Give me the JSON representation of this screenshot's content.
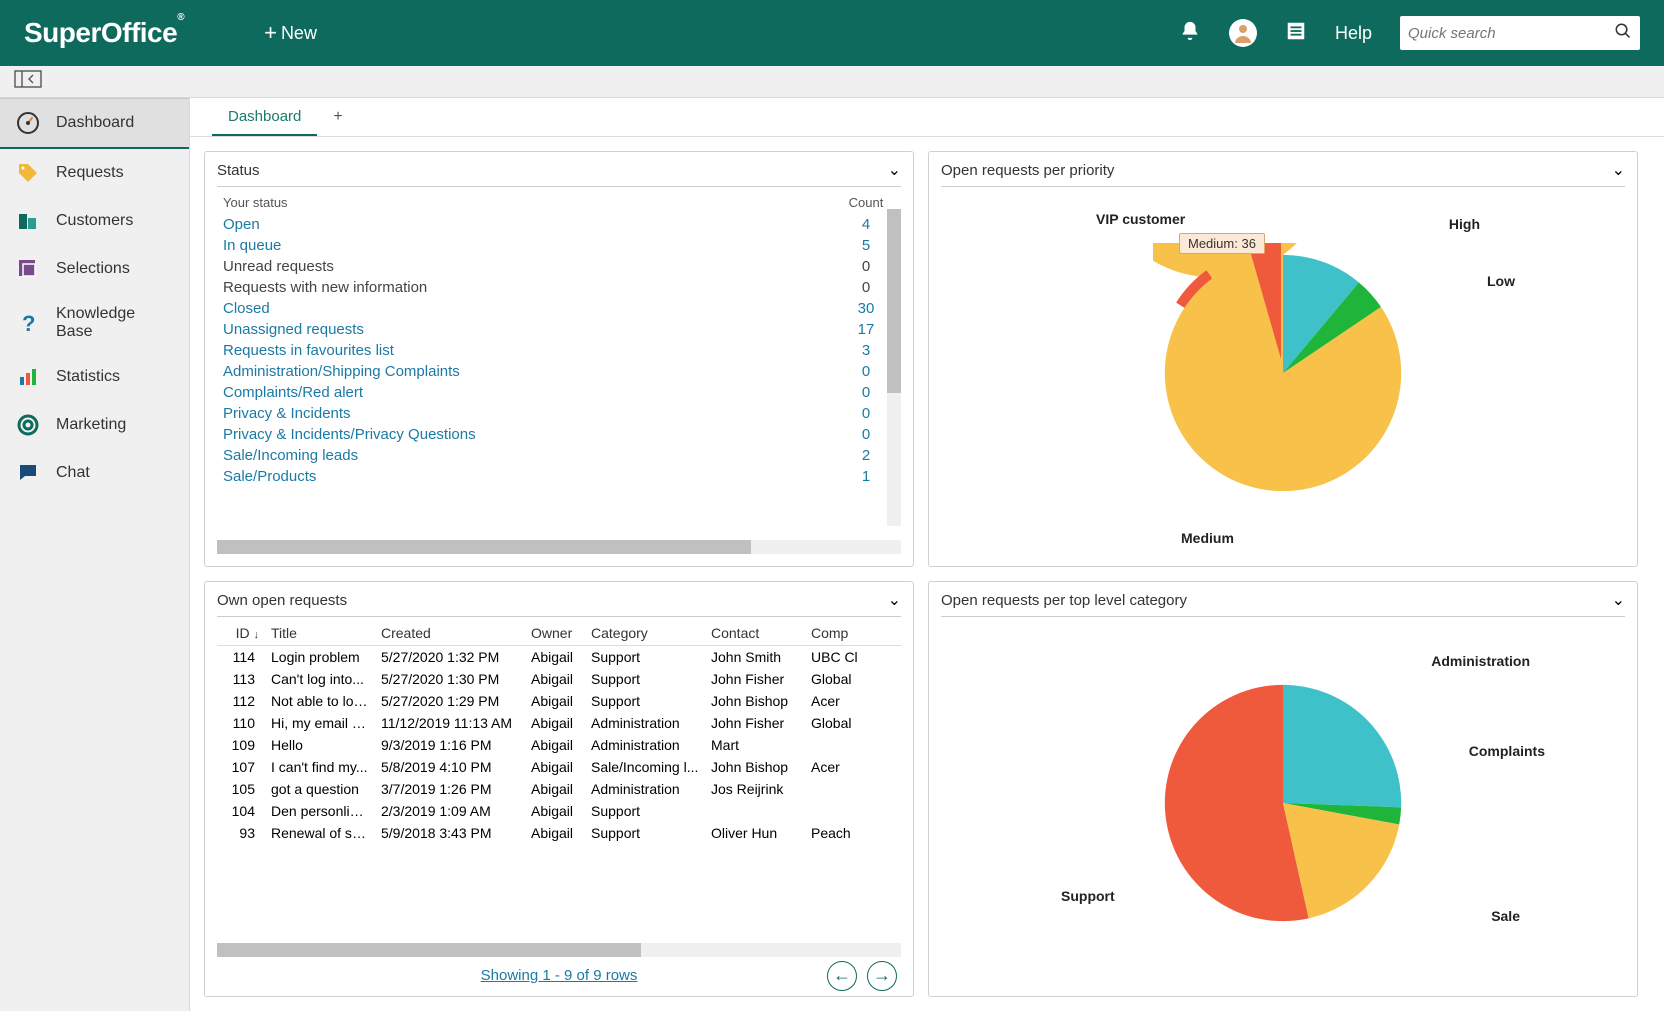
{
  "header": {
    "brand": "SuperOffice",
    "new_label": "New",
    "help_label": "Help",
    "quick_search_placeholder": "Quick search"
  },
  "sidebar": {
    "items": [
      {
        "label": "Dashboard",
        "active": true
      },
      {
        "label": "Requests"
      },
      {
        "label": "Customers"
      },
      {
        "label": "Selections"
      },
      {
        "label": "Knowledge Base"
      },
      {
        "label": "Statistics"
      },
      {
        "label": "Marketing"
      },
      {
        "label": "Chat"
      }
    ]
  },
  "tabs": {
    "main": "Dashboard"
  },
  "panels": {
    "status": {
      "title": "Status"
    },
    "priority": {
      "title": "Open requests per priority"
    },
    "own": {
      "title": "Own open requests"
    },
    "category": {
      "title": "Open requests per top level category"
    }
  },
  "status_headers": {
    "col1": "Your status",
    "col2": "Count"
  },
  "status_rows": [
    {
      "label": "Open",
      "count": "4",
      "link": true
    },
    {
      "label": "In queue",
      "count": "5",
      "link": true
    },
    {
      "label": "Unread requests",
      "count": "0",
      "link": false
    },
    {
      "label": "Requests with new information",
      "count": "0",
      "link": false
    },
    {
      "label": "Closed",
      "count": "30",
      "link": true
    },
    {
      "label": "Unassigned requests",
      "count": "17",
      "link": true
    },
    {
      "label": "Requests in favourites list",
      "count": "3",
      "link": true
    },
    {
      "label": "Administration/Shipping Complaints",
      "count": "0",
      "link": true
    },
    {
      "label": "Complaints/Red alert",
      "count": "0",
      "link": true
    },
    {
      "label": "Privacy & Incidents",
      "count": "0",
      "link": true
    },
    {
      "label": "Privacy & Incidents/Privacy Questions",
      "count": "0",
      "link": true
    },
    {
      "label": "Sale/Incoming leads",
      "count": "2",
      "link": true
    },
    {
      "label": "Sale/Products",
      "count": "1",
      "link": true
    }
  ],
  "requests_headers": [
    "ID",
    "Title",
    "Created",
    "Owner",
    "Category",
    "Contact",
    "Comp"
  ],
  "requests_rows": [
    [
      "114",
      "Login problem",
      "5/27/2020 1:32 PM",
      "Abigail",
      "Support",
      "John Smith",
      "UBC Cl"
    ],
    [
      "113",
      "Can't log into...",
      "5/27/2020 1:30 PM",
      "Abigail",
      "Support",
      "John Fisher",
      "Global"
    ],
    [
      "112",
      "Not able to log...",
      "5/27/2020 1:29 PM",
      "Abigail",
      "Support",
      "John Bishop",
      "Acer"
    ],
    [
      "110",
      "Hi, my email li...",
      "11/12/2019 11:13 AM",
      "Abigail",
      "Administration",
      "John Fisher",
      "Global"
    ],
    [
      "109",
      "Hello",
      "9/3/2019 1:16 PM",
      "Abigail",
      "Administration",
      "Mart",
      ""
    ],
    [
      "107",
      "I can't find my...",
      "5/8/2019 4:10 PM",
      "Abigail",
      "Sale/Incoming l...",
      "John Bishop",
      "Acer"
    ],
    [
      "105",
      "got a question",
      "3/7/2019 1:26 PM",
      "Abigail",
      "Administration",
      "Jos Reijrink",
      ""
    ],
    [
      "104",
      "Den personlige...",
      "2/3/2019 1:09 AM",
      "Abigail",
      "Support",
      "",
      ""
    ],
    [
      "93",
      "Renewal of serv...",
      "5/9/2018 3:43 PM",
      "Abigail",
      "Support",
      "Oliver Hun",
      "Peach"
    ]
  ],
  "requests_footer": "Showing 1 - 9 of 9 rows",
  "priority_tooltip": "Medium: 36",
  "priority_labels": {
    "vip": "VIP customer",
    "high": "High",
    "low": "Low",
    "medium": "Medium"
  },
  "category_labels": {
    "admin": "Administration",
    "complaints": "Complaints",
    "sale": "Sale",
    "support": "Support"
  },
  "chart_data": [
    {
      "type": "pie",
      "title": "Open requests per priority",
      "series": [
        {
          "name": "priority",
          "values": [
            {
              "label": "Medium",
              "value": 36
            },
            {
              "label": "High",
              "value": 5
            },
            {
              "label": "Low",
              "value": 2
            },
            {
              "label": "VIP customer",
              "value": 2
            }
          ]
        }
      ],
      "colors": {
        "Medium": "#f8c24a",
        "High": "#3fc1c9",
        "Low": "#1eb53a",
        "VIP customer": "#ef5a3c"
      }
    },
    {
      "type": "pie",
      "title": "Open requests per top level category",
      "series": [
        {
          "name": "category",
          "values": [
            {
              "label": "Support",
              "value": 23
            },
            {
              "label": "Administration",
              "value": 11
            },
            {
              "label": "Sale",
              "value": 8
            },
            {
              "label": "Complaints",
              "value": 1
            }
          ]
        }
      ],
      "colors": {
        "Support": "#ef5a3c",
        "Administration": "#3fc1c9",
        "Sale": "#f8c24a",
        "Complaints": "#1eb53a"
      }
    }
  ]
}
